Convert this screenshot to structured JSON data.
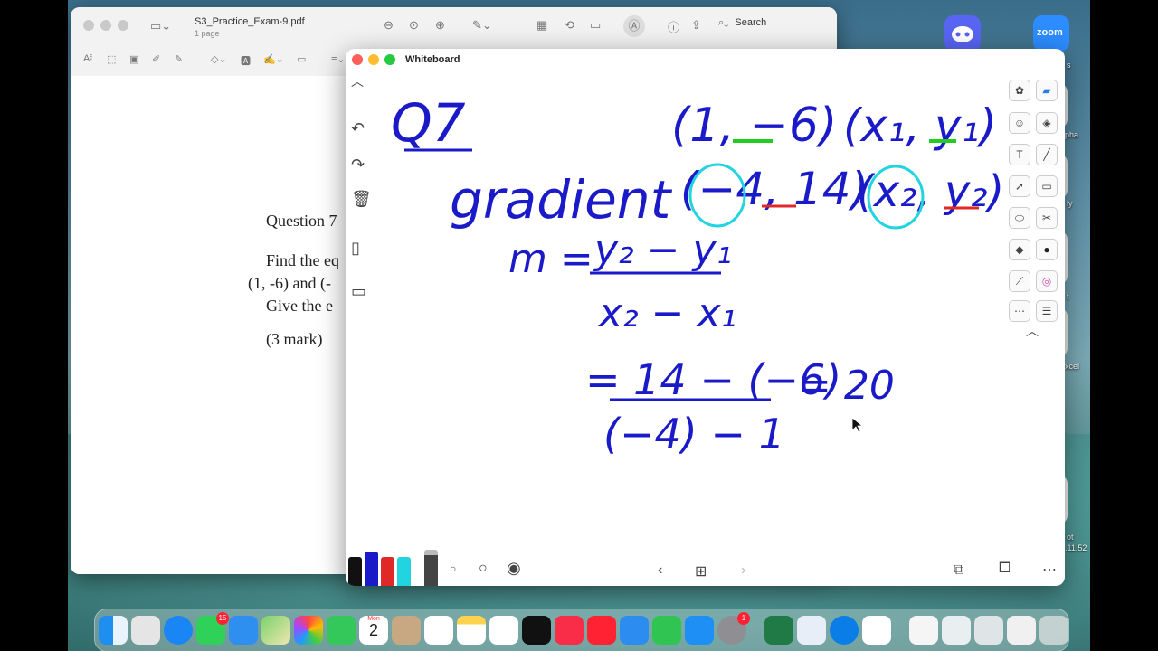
{
  "desktop": {
    "discord_label": "",
    "zoom_label": "zoom",
    "labels": [
      "s",
      "pha",
      "ly",
      "t",
      "xcel",
      "ot",
      ".11.52"
    ]
  },
  "preview": {
    "title": "S3_Practice_Exam-9.pdf",
    "subtitle": "1 page",
    "search_placeholder": "Search",
    "document": {
      "question": "Question 7",
      "line1": "Find the eq",
      "line2": "(1, -6) and (-",
      "line3": "Give the e",
      "marks": "(3 mark)"
    }
  },
  "whiteboard": {
    "title": "Whiteboard",
    "handwriting": {
      "q": "Q7",
      "p1": "(1, −6)",
      "p1g": "(x₁, y₁)",
      "p2": "(−4, 14)",
      "p2g": "(x₂, y₂)",
      "gradient": "gradient",
      "formula_m": "m =",
      "num1": "y₂ − y₁",
      "den1": "x₂ − x₁",
      "num2": "= 14 − (−6)",
      "den2": "(−4) − 1",
      "result": "= 20"
    },
    "colors": {
      "ink": "#1a1ac8",
      "cyan": "#22d3e0",
      "green": "#22cc22",
      "red": "#e02828"
    }
  },
  "dock": {
    "messages_badge": "15",
    "calendar_month": "Mon",
    "calendar_day": "2",
    "settings_badge": "1"
  }
}
